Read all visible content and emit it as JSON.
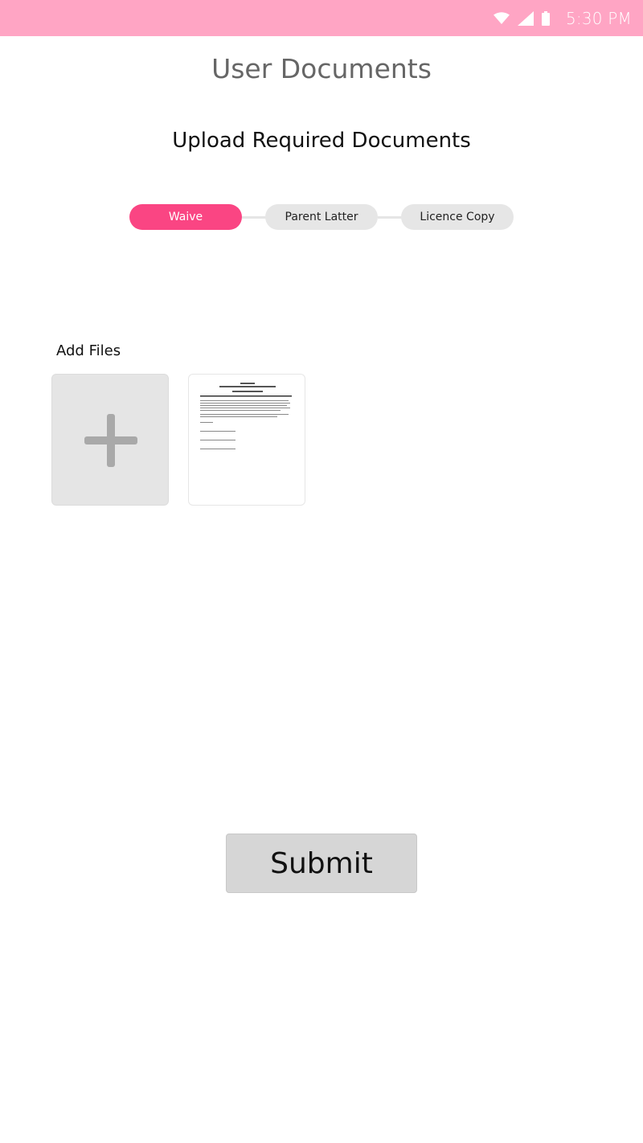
{
  "status_bar": {
    "time": "5:30 PM",
    "background_color": "#ffa5c4",
    "icons": [
      "wifi-icon",
      "signal-icon",
      "battery-icon"
    ]
  },
  "page": {
    "title": "User Documents",
    "section_title": "Upload Required Documents"
  },
  "stepper": {
    "active_color": "#fa4583",
    "inactive_color": "#e6e6e6",
    "steps": [
      {
        "label": "Waive",
        "active": true
      },
      {
        "label": "Parent Latter",
        "active": false
      },
      {
        "label": "Licence Copy",
        "active": false
      }
    ]
  },
  "files": {
    "label": "Add Files",
    "add_icon": "plus-icon",
    "items": [
      {
        "type": "document-thumbnail"
      }
    ]
  },
  "submit": {
    "label": "Submit"
  }
}
